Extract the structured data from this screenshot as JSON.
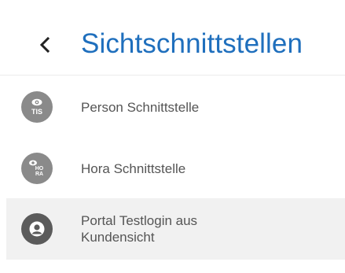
{
  "header": {
    "title": "Sichtschnittstellen",
    "back_icon": "chevron-left-icon"
  },
  "items": [
    {
      "label": "Person Schnittstelle",
      "icon": "eye-tis-icon",
      "icon_text": "TIS",
      "highlighted": false
    },
    {
      "label": "Hora Schnittstelle",
      "icon": "eye-hora-icon",
      "icon_text_1": "HO",
      "icon_text_2": "RA",
      "highlighted": false
    },
    {
      "label_line1": "Portal Testlogin aus",
      "label_line2": "Kundensicht",
      "icon": "user-circle-icon",
      "highlighted": true
    }
  ],
  "colors": {
    "accent": "#1f6fbd",
    "text": "#555555",
    "icon_bg": "#8a8a8a",
    "icon_bg_dark": "#5b5b5b",
    "highlight_bg": "#f1f1f1"
  }
}
